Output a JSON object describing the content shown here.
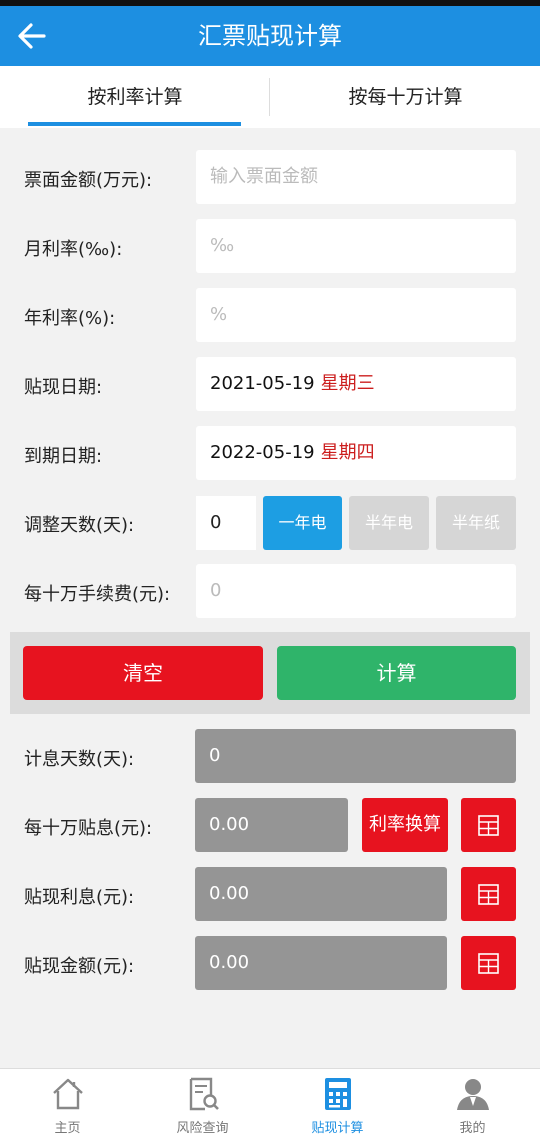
{
  "header": {
    "title": "汇票贴现计算",
    "back_icon": "arrow-left-icon"
  },
  "tabs": [
    {
      "label": "按利率计算",
      "active": true
    },
    {
      "label": "按每十万计算",
      "active": false
    }
  ],
  "form": {
    "face_amount": {
      "label": "票面金额(万元):",
      "placeholder": "输入票面金额"
    },
    "monthly_rate": {
      "label": "月利率(‰):",
      "placeholder": "‰"
    },
    "annual_rate": {
      "label": "年利率(%):",
      "placeholder": "%"
    },
    "discount_date": {
      "label": "贴现日期:",
      "value": "2021-05-19",
      "weekday": "星期三"
    },
    "due_date": {
      "label": "到期日期:",
      "value": "2022-05-19",
      "weekday": "星期四"
    },
    "adjust_days": {
      "label": "调整天数(天):",
      "value": "0",
      "options": [
        "一年电",
        "半年电",
        "半年纸"
      ],
      "selected": "一年电"
    },
    "fee_per_100k": {
      "label": "每十万手续费(元):",
      "placeholder": "0"
    }
  },
  "actions": {
    "clear": "清空",
    "calculate": "计算"
  },
  "results": {
    "interest_days": {
      "label": "计息天数(天):",
      "value": "0"
    },
    "interest_per_100k": {
      "label": "每十万贴息(元):",
      "value": "0.00",
      "button": "利率换算"
    },
    "discount_interest": {
      "label": "贴现利息(元):",
      "value": "0.00"
    },
    "discount_amount": {
      "label": "贴现金额(元):",
      "value": "0.00"
    }
  },
  "colors": {
    "primary": "#1d8fe1",
    "danger": "#e7131f",
    "success": "#2fb46a",
    "weekday": "#cc1e1e"
  },
  "bottom_nav": [
    {
      "label": "主页",
      "icon": "home-icon",
      "active": false
    },
    {
      "label": "风险查询",
      "icon": "document-search-icon",
      "active": false
    },
    {
      "label": "贴现计算",
      "icon": "calculator-icon",
      "active": true
    },
    {
      "label": "我的",
      "icon": "user-icon",
      "active": false
    }
  ]
}
